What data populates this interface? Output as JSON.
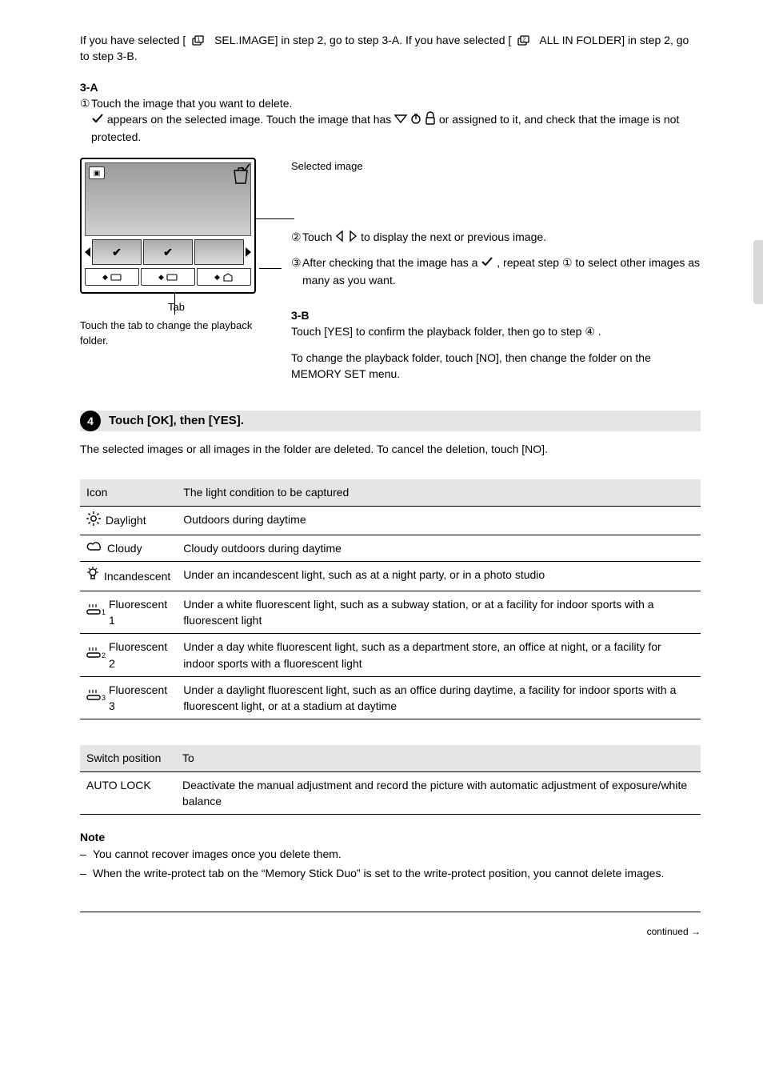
{
  "intro": {
    "p1_a": "If you have selected [",
    "p1_b": "SEL.IMAGE] in step 2, go to step 3-A. If you have selected [",
    "p1_c": "ALL IN FOLDER] in step 2, go to step 3-B."
  },
  "stepA": {
    "label": "3-A",
    "items": [
      {
        "pre": "Touch the image that you want to delete.",
        "post_a": " appears on the selected image. Touch the image that has ",
        "post_b": " or ",
        "post_c": " assigned to it, and check that the image is not protected."
      },
      {
        "pre_a": "Touch ",
        "pre_b": " to display the next or previous image."
      },
      {
        "pre_a": "After checking that the image has a ",
        "pre_b": ", repeat step ",
        "step": "①",
        "post": " to select other images as many as you want."
      }
    ],
    "captions": {
      "img": "Selected image",
      "sel": "Selected image",
      "tab": "Tab",
      "tab_desc": "Touch the tab to change the playback folder."
    }
  },
  "stepB": {
    "label": "3-B",
    "sentence_a": "Touch [YES] to confirm the playback folder, then go to step ",
    "sentence_b": ".",
    "sentence_cancel": "To change the playback folder, touch [NO], then change the folder on the MEMORY SET menu."
  },
  "step4": {
    "num": "4",
    "title": "Touch [OK], then [YES].",
    "desc": "The selected images or all images in the folder are deleted. To cancel the deletion, touch [NO]."
  },
  "table1": {
    "header1": "Icon",
    "header2": "The light condition to be captured",
    "rows": [
      {
        "iconKey": "sun",
        "label": " Daylight",
        "desc": "Outdoors during daytime"
      },
      {
        "iconKey": "cloud",
        "label": " Cloudy",
        "desc": "Cloudy outdoors during daytime"
      },
      {
        "iconKey": "bulb",
        "label": " Incandescent",
        "desc": "Under an incandescent light, such as at a night party, or in a photo studio"
      },
      {
        "iconKey": "f1",
        "label": " Fluorescent 1",
        "desc": "Under a white fluorescent light, such as a subway station, or at a facility for indoor sports with a fluorescent light"
      },
      {
        "iconKey": "f2",
        "label": " Fluorescent 2",
        "desc": "Under a day white fluorescent light, such as a department store, an office at night, or a facility for indoor sports with a fluorescent light"
      },
      {
        "iconKey": "f3",
        "label": " Fluorescent 3",
        "desc": "Under a daylight fluorescent light, such as an office during daytime, a facility for indoor sports with a fluorescent light, or at a stadium at daytime"
      }
    ]
  },
  "table2": {
    "header1": "Switch position",
    "header2": "To",
    "rows": [
      {
        "c1": "AUTO LOCK",
        "c2": "Deactivate the manual adjustment and record the picture with automatic adjustment of exposure/white balance"
      }
    ]
  },
  "note": {
    "label": "Note",
    "items": [
      {
        "text": "You cannot recover images once you delete them."
      },
      {
        "text": "When the write-protect tab on the “Memory Stick Duo” is set to the write-protect position, you cannot delete images."
      }
    ]
  },
  "footer": {
    "continued": "continued",
    "arrow": "→"
  }
}
